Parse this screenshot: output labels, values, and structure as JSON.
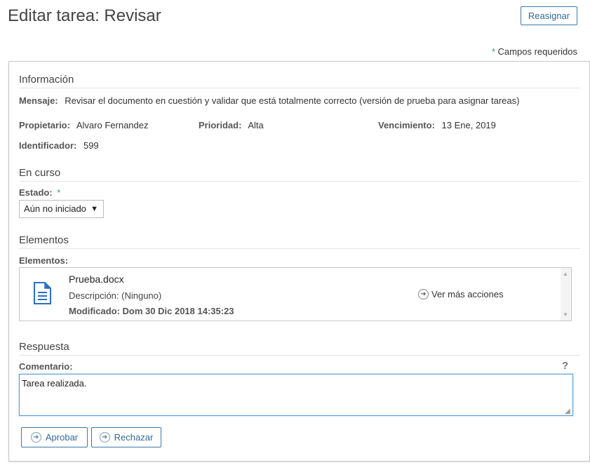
{
  "page": {
    "title": "Editar tarea: Revisar",
    "reassign_label": "Reasignar",
    "required_star": "*",
    "required_text": "Campos requeridos"
  },
  "info": {
    "heading": "Información",
    "message_label": "Mensaje:",
    "message_value": "Revisar el documento en cuestión y validar que está totalmente correcto (versión de prueba para asignar tareas)",
    "owner_label": "Propietario:",
    "owner_value": "Alvaro Fernandez",
    "priority_label": "Prioridad:",
    "priority_value": "Alta",
    "due_label": "Vencimiento:",
    "due_value": "13 Ene, 2019",
    "id_label": "Identificador:",
    "id_value": "599"
  },
  "progress": {
    "heading": "En curso",
    "status_label": "Estado:",
    "status_star": "*",
    "status_value": "Aún no iniciado"
  },
  "items": {
    "heading": "Elementos",
    "label": "Elementos:",
    "file_name": "Prueba.docx",
    "file_description": "Descripción: (Ninguno)",
    "file_modified": "Modificado: Dom 30 Dic 2018 14:35:23",
    "more_actions": "Ver más acciones",
    "icon": "document-icon"
  },
  "response": {
    "heading": "Respuesta",
    "comment_label": "Comentario:",
    "help_glyph": "?",
    "comment_value": "Tarea realizada.",
    "approve_label": "Aprobar",
    "reject_label": "Rechazar"
  },
  "colors": {
    "accent": "#2f6a9a",
    "required_star": "#38a169",
    "focus_border": "#5b9bd5",
    "doc_icon": "#2b6fc4"
  }
}
